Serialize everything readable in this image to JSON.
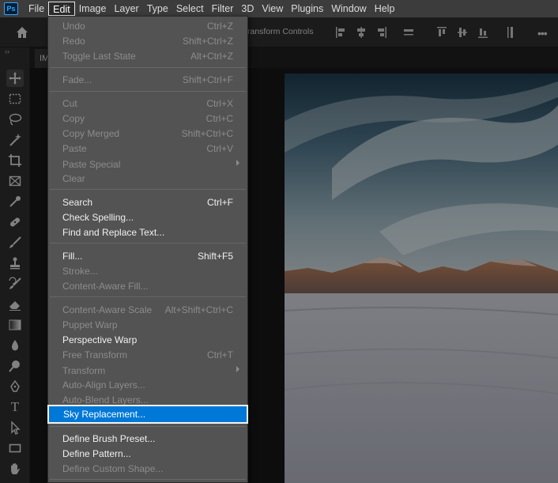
{
  "menubar": {
    "logo": "Ps",
    "items": [
      "File",
      "Edit",
      "Image",
      "Layer",
      "Type",
      "Select",
      "Filter",
      "3D",
      "View",
      "Plugins",
      "Window",
      "Help"
    ],
    "active": "Edit"
  },
  "options_bar": {
    "partial_text": "ransform Controls"
  },
  "document": {
    "tab_label": "IM"
  },
  "edit_menu": {
    "items": [
      {
        "label": "Undo",
        "shortcut": "Ctrl+Z",
        "disabled": true
      },
      {
        "label": "Redo",
        "shortcut": "Shift+Ctrl+Z",
        "disabled": true
      },
      {
        "label": "Toggle Last State",
        "shortcut": "Alt+Ctrl+Z",
        "disabled": true
      },
      {
        "label": "Fade...",
        "shortcut": "Shift+Ctrl+F",
        "disabled": true
      },
      {
        "label": "Cut",
        "shortcut": "Ctrl+X",
        "disabled": true
      },
      {
        "label": "Copy",
        "shortcut": "Ctrl+C",
        "disabled": true
      },
      {
        "label": "Copy Merged",
        "shortcut": "Shift+Ctrl+C",
        "disabled": true
      },
      {
        "label": "Paste",
        "shortcut": "Ctrl+V",
        "disabled": true
      },
      {
        "label": "Paste Special",
        "shortcut": "",
        "disabled": true,
        "submenu": true
      },
      {
        "label": "Clear",
        "shortcut": "",
        "disabled": true
      },
      {
        "label": "Search",
        "shortcut": "Ctrl+F",
        "disabled": false
      },
      {
        "label": "Check Spelling...",
        "shortcut": "",
        "disabled": false
      },
      {
        "label": "Find and Replace Text...",
        "shortcut": "",
        "disabled": false
      },
      {
        "label": "Fill...",
        "shortcut": "Shift+F5",
        "disabled": false
      },
      {
        "label": "Stroke...",
        "shortcut": "",
        "disabled": true
      },
      {
        "label": "Content-Aware Fill...",
        "shortcut": "",
        "disabled": true
      },
      {
        "label": "Content-Aware Scale",
        "shortcut": "Alt+Shift+Ctrl+C",
        "disabled": true
      },
      {
        "label": "Puppet Warp",
        "shortcut": "",
        "disabled": true
      },
      {
        "label": "Perspective Warp",
        "shortcut": "",
        "disabled": false
      },
      {
        "label": "Free Transform",
        "shortcut": "Ctrl+T",
        "disabled": true
      },
      {
        "label": "Transform",
        "shortcut": "",
        "disabled": true,
        "submenu": true
      },
      {
        "label": "Auto-Align Layers...",
        "shortcut": "",
        "disabled": true
      },
      {
        "label": "Auto-Blend Layers...",
        "shortcut": "",
        "disabled": true
      },
      {
        "label": "Sky Replacement...",
        "shortcut": "",
        "disabled": false,
        "highlighted": true
      },
      {
        "label": "Define Brush Preset...",
        "shortcut": "",
        "disabled": false
      },
      {
        "label": "Define Pattern...",
        "shortcut": "",
        "disabled": false
      },
      {
        "label": "Define Custom Shape...",
        "shortcut": "",
        "disabled": true
      }
    ]
  },
  "toolbar": {
    "collapse_glyph": "››",
    "tools": [
      "move-tool",
      "marquee-tool",
      "lasso-tool",
      "magic-wand-tool",
      "crop-tool",
      "frame-tool",
      "eyedropper-tool",
      "healing-brush-tool",
      "brush-tool",
      "clone-stamp-tool",
      "history-brush-tool",
      "eraser-tool",
      "gradient-tool",
      "blur-tool",
      "dodge-tool",
      "pen-tool",
      "type-tool",
      "path-selection-tool",
      "rectangle-tool",
      "hand-tool"
    ],
    "type_tool_glyph": "T"
  },
  "colors": {
    "highlight": "#0078d7",
    "menu_bg": "#535353",
    "logo_accent": "#31a8ff"
  }
}
